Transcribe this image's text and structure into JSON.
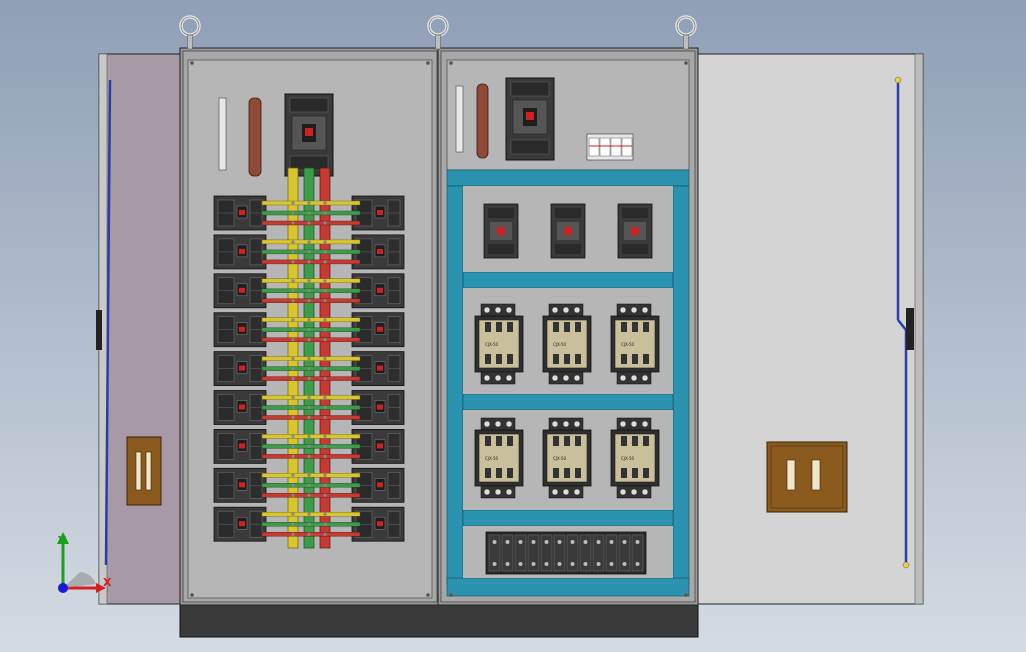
{
  "view": {
    "background_top": "#8f9fb6",
    "background_bottom": "#d4dbe3"
  },
  "colors": {
    "panel_gray": "#b6b6b6",
    "door_left": "#a799a6",
    "door_right": "#d4d4d4",
    "frame": "#9a9a9a",
    "base": "#3a3a3a",
    "busbar_yellow": "#d8c530",
    "busbar_green": "#3f9b4a",
    "busbar_red": "#c43b34",
    "cable_blue": "#2a3ea8",
    "duct_teal": "#2b93b0",
    "breaker_dark": "#3a3a3a",
    "contactor_beige": "#c9bf9a",
    "handle_brown": "#8a5a1e",
    "copper_bar": "#8e4a36"
  },
  "labels": {
    "contactor_labels": [
      "CJX-50",
      "CJX-50",
      "CJX-50",
      "CJX-50",
      "CJX-50",
      "CJX-50"
    ]
  },
  "triad": {
    "x_label": "X",
    "y_label": "Y",
    "x_color": "#d42020",
    "y_color": "#1aa01a",
    "z_color": "#1a1ad4"
  }
}
